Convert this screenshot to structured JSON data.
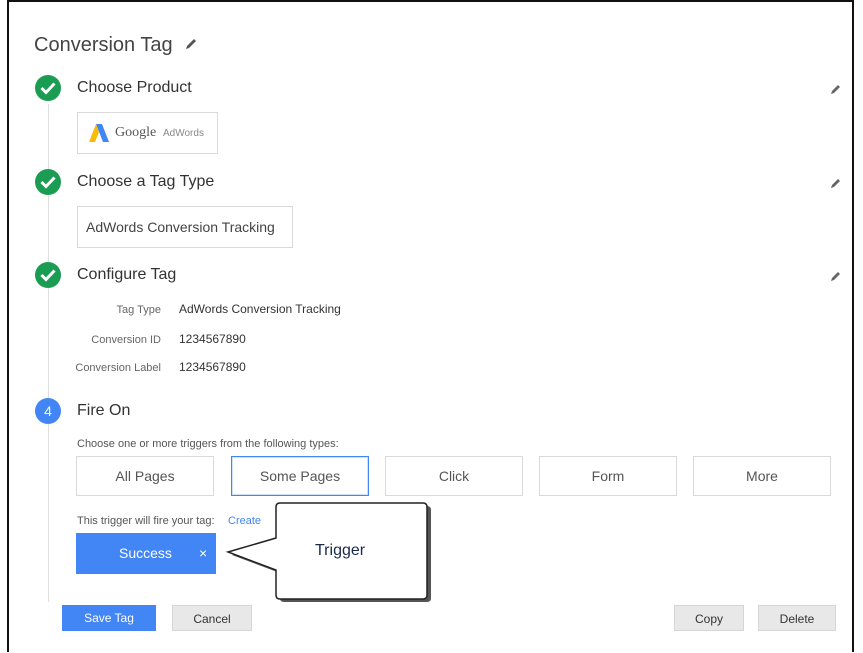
{
  "header": {
    "title": "Conversion Tag"
  },
  "steps": [
    {
      "title": "Choose Product"
    },
    {
      "title": "Choose a Tag Type"
    },
    {
      "title": "Configure Tag"
    },
    {
      "title": "Fire On",
      "number": "4"
    }
  ],
  "product": {
    "logo_word": "Google",
    "logo_sub": "AdWords"
  },
  "tag_type": {
    "value": "AdWords Conversion Tracking"
  },
  "configure": {
    "rows": [
      {
        "label": "Tag Type",
        "value": "AdWords Conversion Tracking"
      },
      {
        "label": "Conversion ID",
        "value": "1234567890"
      },
      {
        "label": "Conversion Label",
        "value": "1234567890"
      }
    ]
  },
  "fire_on": {
    "helper": "Choose one or more triggers from the following types:",
    "types": [
      "All Pages",
      "Some Pages",
      "Click",
      "Form",
      "More"
    ],
    "selected": "Some Pages",
    "trigger_helper": "This trigger will fire your tag:",
    "create_link": "Create",
    "chip_label": "Success",
    "chip_remove": "×"
  },
  "callout": {
    "text": "Trigger"
  },
  "footer": {
    "save_label": "Save Tag",
    "cancel_label": "Cancel",
    "copy_label": "Copy",
    "delete_label": "Delete"
  },
  "colors": {
    "accent": "#4285f4",
    "success": "#1a9c52",
    "adwords_yellow": "#fbbc05"
  },
  "icons": {
    "title_edit": "pencil-icon",
    "step_edit": "pencil-icon",
    "step_done": "check-circle-icon",
    "chip_close": "close-icon"
  }
}
